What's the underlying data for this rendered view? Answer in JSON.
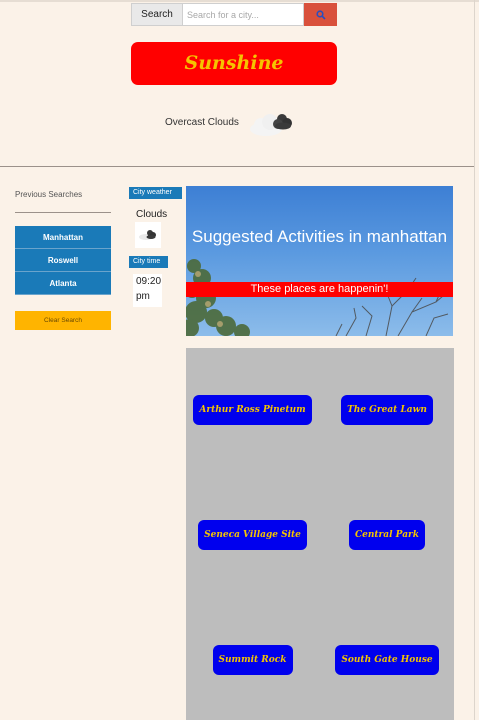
{
  "search": {
    "label": "Search",
    "placeholder": "Search for a city...",
    "button_icon": "search-icon"
  },
  "brand": {
    "title": "Sunshine"
  },
  "current": {
    "description": "Overcast Clouds",
    "icon": "overcast-clouds-icon"
  },
  "sidebar": {
    "title": "Previous Searches",
    "history": [
      "Manhattan",
      "Roswell",
      "Atlanta"
    ],
    "clear_label": "Clear Search"
  },
  "city_weather": {
    "label": "City weather",
    "value": "Clouds",
    "icon": "clouds-icon"
  },
  "city_time": {
    "label": "City time",
    "line1": "09:20",
    "line2": "pm"
  },
  "hero": {
    "title": "Suggested Activities in manhattan",
    "banner": "These places are happenin'!"
  },
  "activities": [
    "Arthur Ross Pinetum",
    "The Great Lawn",
    "Seneca Village Site",
    "Central Park",
    "Summit Rock",
    "South Gate House"
  ],
  "colors": {
    "background": "#fbf2e8",
    "brand_bg": "#ff0000",
    "brand_text": "#f5c400",
    "accent_blue": "#1a7ab8",
    "activity_button": "#0000ee",
    "clear_button": "#ffb400"
  }
}
